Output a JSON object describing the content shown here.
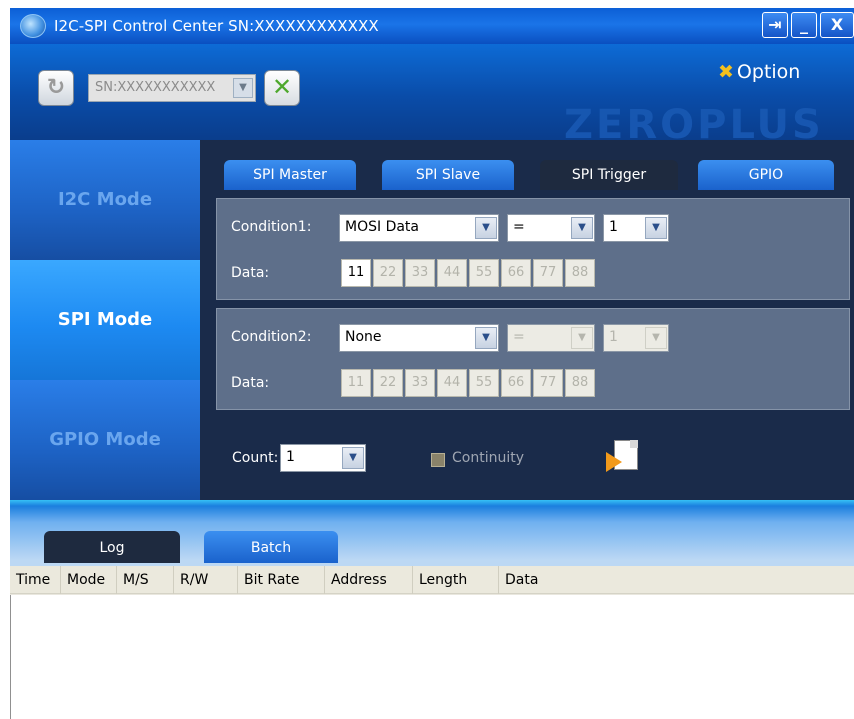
{
  "window": {
    "title": "I2C-SPI Control Center SN:XXXXXXXXXXXX",
    "buttons": {
      "pin": "⇥",
      "minimize": "_",
      "close": "X"
    }
  },
  "header": {
    "serial_select": "SN:XXXXXXXXXXX",
    "option_label": "Option",
    "brand": "ZEROPLUS"
  },
  "nav": {
    "modes": [
      {
        "label": "I2C Mode",
        "selected": false
      },
      {
        "label": "SPI Mode",
        "selected": true
      },
      {
        "label": "GPIO Mode",
        "selected": false
      }
    ]
  },
  "tabs": [
    {
      "label": "SPI Master",
      "active": false
    },
    {
      "label": "SPI Slave",
      "active": false
    },
    {
      "label": "SPI Trigger",
      "active": true
    },
    {
      "label": "GPIO",
      "active": false
    }
  ],
  "condition1": {
    "label": "Condition1:",
    "source": "MOSI Data",
    "operator": "=",
    "bytes": "1",
    "data_label": "Data:",
    "data": [
      "11",
      "22",
      "33",
      "44",
      "55",
      "66",
      "77",
      "88"
    ],
    "enabled_cells": 1
  },
  "condition2": {
    "label": "Condition2:",
    "source": "None",
    "operator": "=",
    "bytes": "1",
    "data_label": "Data:",
    "data": [
      "11",
      "22",
      "33",
      "44",
      "55",
      "66",
      "77",
      "88"
    ],
    "enabled_cells": 0
  },
  "count": {
    "label": "Count:",
    "value": "1",
    "continuity_label": "Continuity"
  },
  "bottom_tabs": [
    {
      "label": "Log",
      "active": true
    },
    {
      "label": "Batch",
      "active": false
    }
  ],
  "log_table": {
    "columns": [
      "Time",
      "Mode",
      "M/S",
      "R/W",
      "Bit Rate",
      "Address",
      "Length",
      "Data"
    ],
    "rows": []
  },
  "colors": {
    "title_bar": "#1a74e8",
    "header_blue": "#0a4ca8",
    "panel_dark": "#1a2b4a",
    "condition_panel": "#5e6f8a",
    "selected_mode": "#1d8af2"
  }
}
